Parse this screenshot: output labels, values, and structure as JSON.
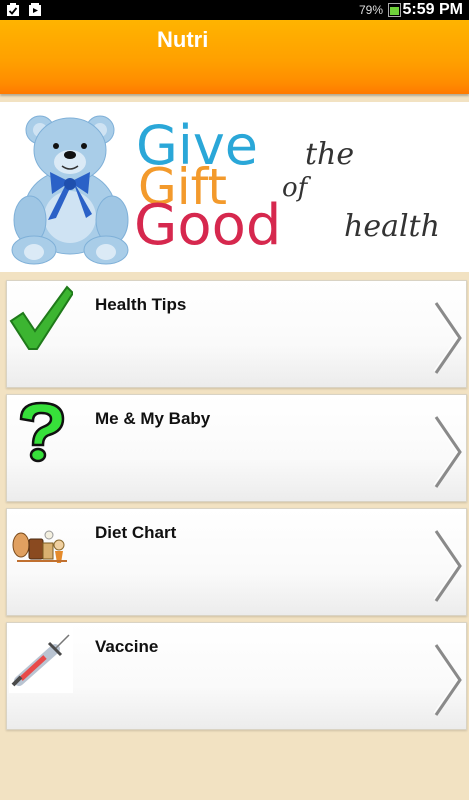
{
  "status_bar": {
    "battery_percent": "79%",
    "battery_level": 0.79,
    "time": "5:59 PM",
    "left_icons": [
      "check-clipboard-icon",
      "play-store-icon"
    ]
  },
  "action_bar": {
    "title": "Nutri",
    "color": "#ffa000"
  },
  "banner": {
    "words": {
      "give": "Give",
      "the": "the",
      "gift": "Gift",
      "of": "of",
      "good": "Good",
      "health": "health"
    },
    "colors": {
      "give": "#2aa7d8",
      "gift": "#f39a2c",
      "good": "#d6284e",
      "script": "#333333"
    },
    "icon": "teddy-bear-icon"
  },
  "menu": {
    "items": [
      {
        "label": "Health Tips",
        "icon": "checkmark-icon"
      },
      {
        "label": "Me & My Baby",
        "icon": "question-mark-icon"
      },
      {
        "label": "Diet Chart",
        "icon": "food-icon"
      },
      {
        "label": "Vaccine",
        "icon": "syringe-icon"
      }
    ]
  }
}
